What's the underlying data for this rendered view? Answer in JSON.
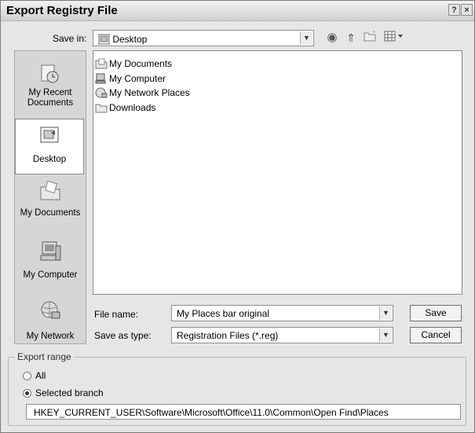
{
  "window": {
    "title": "Export Registry File",
    "help_icon": "?",
    "close_icon": "×"
  },
  "save_in": {
    "label": "Save in:",
    "value": "Desktop",
    "toolbar_icons": [
      "back-icon",
      "up-folder-icon",
      "new-folder-icon",
      "views-menu-icon"
    ]
  },
  "places_bar": {
    "items": [
      {
        "label": "My Recent Documents",
        "icon": "recent-documents-icon"
      },
      {
        "label": "Desktop",
        "icon": "desktop-icon",
        "selected": true
      },
      {
        "label": "My Documents",
        "icon": "my-documents-icon"
      },
      {
        "label": "My Computer",
        "icon": "my-computer-icon"
      },
      {
        "label": "My Network",
        "icon": "my-network-icon"
      }
    ]
  },
  "file_list": {
    "items": [
      {
        "label": "My Documents",
        "icon": "folder-documents-icon"
      },
      {
        "label": "My Computer",
        "icon": "computer-icon"
      },
      {
        "label": "My Network Places",
        "icon": "network-places-icon"
      },
      {
        "label": "Downloads",
        "icon": "folder-icon"
      }
    ]
  },
  "form": {
    "file_name_label": "File name:",
    "file_name_value": "My Places bar original",
    "save_as_type_label": "Save as type:",
    "save_as_type_value": "Registration Files (*.reg)",
    "save_button": "Save",
    "cancel_button": "Cancel"
  },
  "export_range": {
    "title": "Export range",
    "all_label": "All",
    "selected_branch_label": "Selected branch",
    "selected": "selected_branch",
    "branch_path": "HKEY_CURRENT_USER\\Software\\Microsoft\\Office\\11.0\\Common\\Open Find\\Places"
  }
}
